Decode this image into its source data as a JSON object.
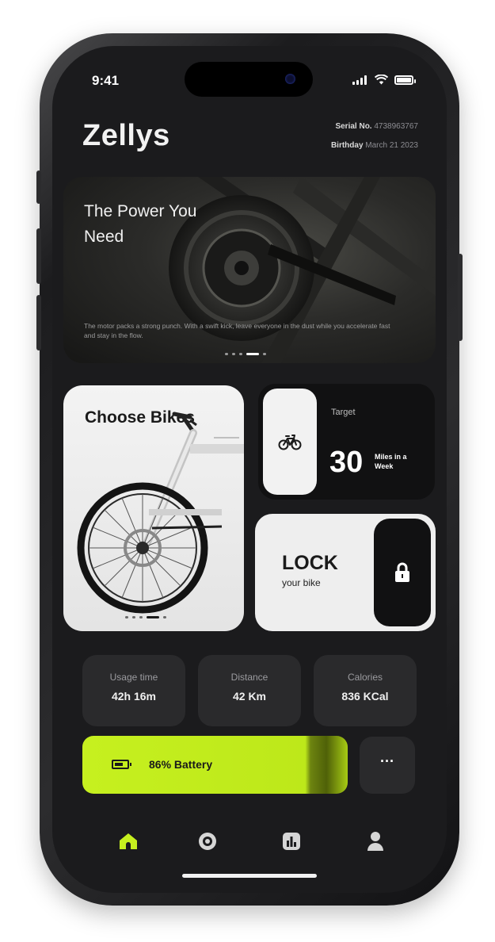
{
  "status_bar": {
    "time": "9:41"
  },
  "header": {
    "title": "Zellys",
    "serial_label": "Serial No.",
    "serial_value": "4738963767",
    "birthday_label": "Birthday",
    "birthday_value": "March 21 2023"
  },
  "hero": {
    "title": "The Power You Need",
    "description": "The motor packs a strong punch. With a swift kick, leave everyone in the dust while you accelerate fast and stay in the flow."
  },
  "choose_bikes": {
    "label": "Choose Bikes"
  },
  "target": {
    "label": "Target",
    "value": "30",
    "unit": "Miles in a Week"
  },
  "lock": {
    "title": "LOCK",
    "subtitle": "your bike"
  },
  "stats": [
    {
      "label": "Usage time",
      "value": "42h 16m"
    },
    {
      "label": "Distance",
      "value": "42 Km"
    },
    {
      "label": "Calories",
      "value": "836 KCal"
    }
  ],
  "battery": {
    "label": "86% Battery",
    "percent": 86
  },
  "more_button": {
    "label": "···"
  },
  "nav": {
    "items": [
      {
        "icon": "home-icon",
        "active": true
      },
      {
        "icon": "ride-icon",
        "active": false
      },
      {
        "icon": "stats-icon",
        "active": false
      },
      {
        "icon": "profile-icon",
        "active": false
      }
    ]
  },
  "colors": {
    "accent": "#c6f01f",
    "background": "#1b1b1d",
    "card_dark": "#2a2a2c",
    "card_light": "#eeeeee"
  }
}
